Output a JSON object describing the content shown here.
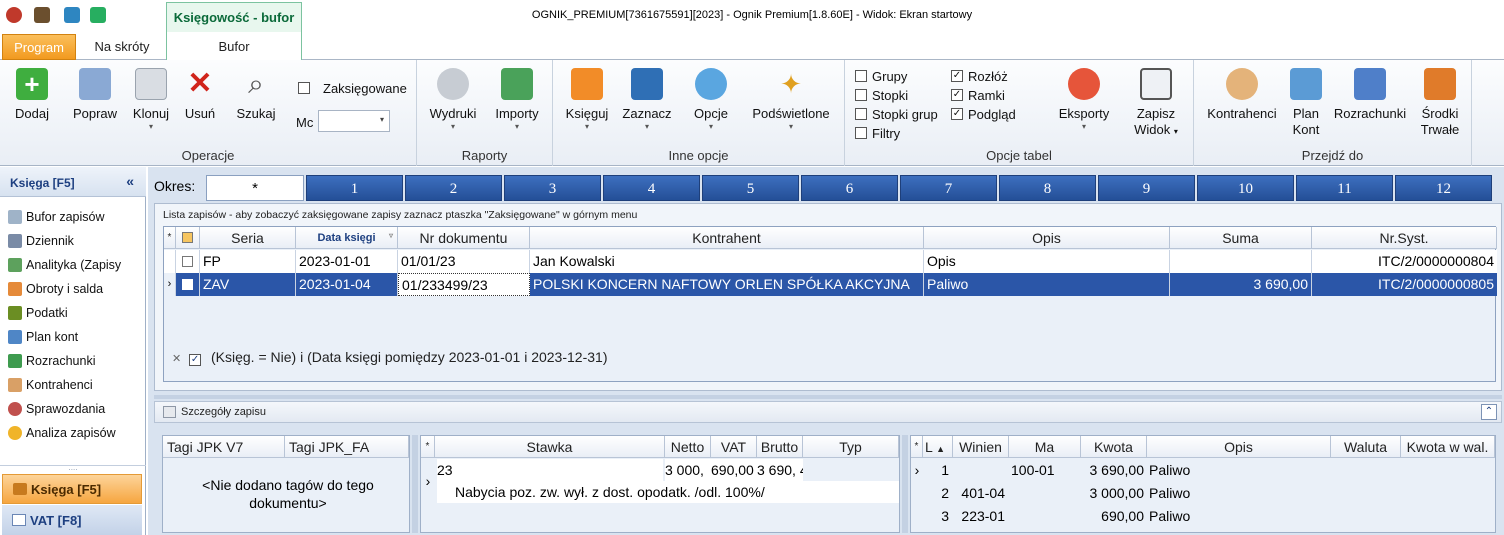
{
  "window": {
    "title": "OGNIK_PREMIUM[7361675591][2023] - Ognik Premium[1.8.60E] - Widok: Ekran startowy"
  },
  "context_tab": "Księgowość - bufor",
  "ribbon_tabs": {
    "program": "Program",
    "na_skroty": "Na skróty",
    "bufor": "Bufor"
  },
  "ribbon": {
    "operacje": {
      "label": "Operacje",
      "dodaj": "Dodaj",
      "popraw": "Popraw",
      "klonuj": "Klonuj",
      "usun": "Usuń",
      "szukaj": "Szukaj",
      "zaksiegowane": "Zaksięgowane",
      "mc": "Mc"
    },
    "raporty": {
      "label": "Raporty",
      "wydruki": "Wydruki",
      "importy": "Importy"
    },
    "inne": {
      "label": "Inne opcje",
      "ksieguj": "Księguj",
      "zaznacz": "Zaznacz",
      "opcje": "Opcje",
      "podswietlone": "Podświetlone"
    },
    "opcje_tabel": {
      "label": "Opcje tabel",
      "grupy": "Grupy",
      "stopki": "Stopki",
      "stopki_grup": "Stopki grup",
      "filtry": "Filtry",
      "rozloz": "Rozłóż",
      "ramki": "Ramki",
      "podglad": "Podgląd",
      "eksporty": "Eksporty",
      "zapisz": "Zapisz",
      "widok": "Widok"
    },
    "przejdz": {
      "label": "Przejdź do",
      "kontrahenci": "Kontrahenci",
      "plan": "Plan",
      "kont": "Kont",
      "rozrachunki": "Rozrachunki",
      "srodki": "Środki",
      "trwale": "Trwałe"
    }
  },
  "sidebar": {
    "header": "Księga [F5]",
    "collapse": "«",
    "items": [
      "Bufor zapisów",
      "Dziennik",
      "Analityka (Zapisy",
      "Obroty i salda",
      "Podatki",
      "Plan kont",
      "Rozrachunki",
      "Kontrahenci",
      "Sprawozdania",
      "Analiza zapisów"
    ],
    "bottom_active": "Księga [F5]",
    "bottom_other": "VAT [F8]"
  },
  "okres": {
    "label": "Okres:",
    "all": "*",
    "months": [
      "1",
      "2",
      "3",
      "4",
      "5",
      "6",
      "7",
      "8",
      "9",
      "10",
      "11",
      "12"
    ]
  },
  "list": {
    "hint": "Lista zapisów - aby zobaczyć zaksięgowane zapisy zaznacz ptaszka \"Zaksięgowane\" w górnym menu",
    "columns": {
      "seria": "Seria",
      "data": "Data księgi",
      "nr": "Nr dokumentu",
      "kontrahent": "Kontrahent",
      "opis": "Opis",
      "suma": "Suma",
      "nrsyst": "Nr.Syst."
    },
    "rows": [
      {
        "seria": "FP",
        "data": "2023-01-01",
        "nr": "01/01/23",
        "kontrahent": "Jan Kowalski",
        "opis": "Opis",
        "suma": "",
        "nrsyst": "ITC/2/0000000804"
      },
      {
        "seria": "ZAV",
        "data": "2023-01-04",
        "nr": "01/233499/23",
        "kontrahent": "POLSKI KONCERN NAFTOWY ORLEN SPÓŁKA AKCYJNA",
        "opis": "Paliwo",
        "suma": "3 690,00",
        "nrsyst": "ITC/2/0000000805"
      }
    ],
    "filter": "(Księg. = Nie) i (Data księgi pomiędzy 2023-01-01 i 2023-12-31)"
  },
  "details": {
    "header": "Szczegóły zapisu",
    "tags": {
      "col1": "Tagi JPK V7",
      "col2": "Tagi JPK_FA",
      "empty": "<Nie dodano tagów do tego dokumentu>"
    },
    "vat": {
      "cols": {
        "stawka": "Stawka",
        "netto": "Netto",
        "vat": "VAT",
        "brutto": "Brutto",
        "typ": "Typ"
      },
      "row": {
        "stawka": "23",
        "netto": "3 000,",
        "vat": "690,00",
        "brutto": "3 690, 4"
      },
      "desc": "Nabycia poz. zw. wył. z dost. opodatk. /odl. 100%/"
    },
    "entries": {
      "cols": {
        "l": "L",
        "winien": "Winien",
        "ma": "Ma",
        "kwota": "Kwota",
        "opis": "Opis",
        "waluta": "Waluta",
        "kwota_wal": "Kwota w wal."
      },
      "rows": [
        {
          "l": "1",
          "winien": "",
          "ma": "100-01",
          "kwota": "3 690,00",
          "opis": "Paliwo"
        },
        {
          "l": "2",
          "winien": "401-04",
          "ma": "",
          "kwota": "3 000,00",
          "opis": "Paliwo"
        },
        {
          "l": "3",
          "winien": "223-01",
          "ma": "",
          "kwota": "690,00",
          "opis": "Paliwo"
        }
      ]
    }
  }
}
